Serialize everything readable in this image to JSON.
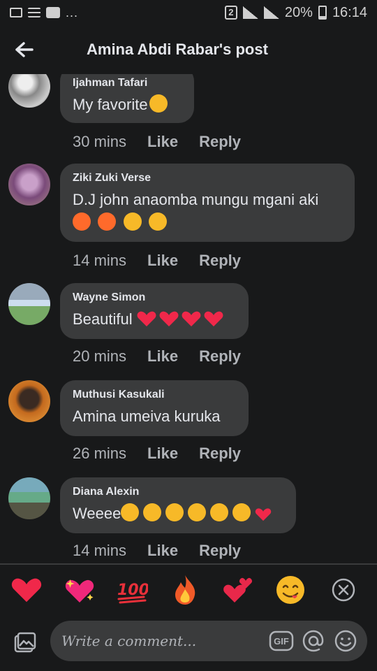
{
  "status_bar": {
    "battery_text": "20%",
    "time": "16:14",
    "notif_count": "2",
    "dots": "..."
  },
  "header": {
    "title": "Amina Abdi Rabar's post"
  },
  "actions": {
    "like": "Like",
    "reply": "Reply"
  },
  "comments": [
    {
      "author": "Ijahman Tafari",
      "text": "My favorite",
      "time": "30 mins"
    },
    {
      "author": "Ziki Zuki Verse",
      "text": "D.J john anaomba mungu mgani aki",
      "time": "14 mins"
    },
    {
      "author": "Wayne Simon",
      "text": "Beautiful ",
      "time": "20 mins"
    },
    {
      "author": "Muthusi Kasukali",
      "text": "Amina umeiva kuruka",
      "time": "26 mins"
    },
    {
      "author": "Diana Alexin",
      "text": "Weeee",
      "time": "14 mins"
    }
  ],
  "reactions": [
    "red-heart",
    "sparkling-heart",
    "hundred-points",
    "fire",
    "two-hearts",
    "savoring-food-face"
  ],
  "composer": {
    "placeholder": "Write a comment...",
    "gif_label": "GIF"
  },
  "colors": {
    "background": "#18191a",
    "bubble": "#3a3b3c",
    "text": "#e4e6eb",
    "muted": "#b0b3b8",
    "heart": "#f0284a",
    "emoji_yellow": "#f7b928"
  }
}
